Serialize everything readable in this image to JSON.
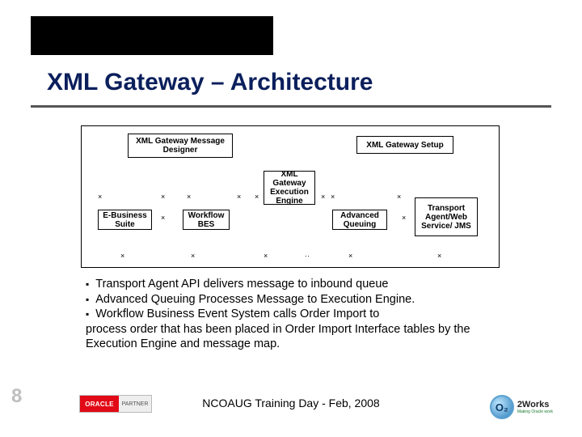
{
  "slide": {
    "title": "XML Gateway – Architecture",
    "page_number": "8",
    "footer": "NCOAUG Training Day - Feb, 2008"
  },
  "diagram": {
    "boxes": {
      "designer": "XML Gateway Message Designer",
      "setup": "XML Gateway Setup",
      "engine": "XML Gateway Execution Engine",
      "ebiz": "E-Business Suite",
      "wfbes": "Workflow BES",
      "aq": "Advanced Queuing",
      "transport": "Transport Agent/Web Service/ JMS"
    }
  },
  "bullets": {
    "b1": "Transport Agent API delivers message to inbound queue",
    "b2": "Advanced Queuing Processes Message to Execution Engine.",
    "b3_line1": "Workflow Business Event System calls Order Import to",
    "b3_line2": "process order that has been placed in Order Import Interface tables by the Execution Engine and message map."
  },
  "logos": {
    "oracle_mark": "ORACLE",
    "oracle_partner": "PARTNER",
    "o2_mark": "O₂",
    "o2_name": "2Works",
    "o2_tag": "Making Oracle work"
  }
}
